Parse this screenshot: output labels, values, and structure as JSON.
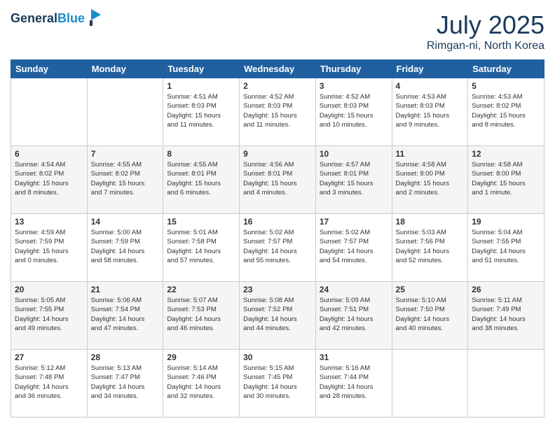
{
  "header": {
    "logo_line1": "General",
    "logo_line2": "Blue",
    "month": "July 2025",
    "location": "Rimgan-ni, North Korea"
  },
  "weekdays": [
    "Sunday",
    "Monday",
    "Tuesday",
    "Wednesday",
    "Thursday",
    "Friday",
    "Saturday"
  ],
  "weeks": [
    [
      {
        "day": "",
        "info": ""
      },
      {
        "day": "",
        "info": ""
      },
      {
        "day": "1",
        "info": "Sunrise: 4:51 AM\nSunset: 8:03 PM\nDaylight: 15 hours\nand 11 minutes."
      },
      {
        "day": "2",
        "info": "Sunrise: 4:52 AM\nSunset: 8:03 PM\nDaylight: 15 hours\nand 11 minutes."
      },
      {
        "day": "3",
        "info": "Sunrise: 4:52 AM\nSunset: 8:03 PM\nDaylight: 15 hours\nand 10 minutes."
      },
      {
        "day": "4",
        "info": "Sunrise: 4:53 AM\nSunset: 8:03 PM\nDaylight: 15 hours\nand 9 minutes."
      },
      {
        "day": "5",
        "info": "Sunrise: 4:53 AM\nSunset: 8:02 PM\nDaylight: 15 hours\nand 8 minutes."
      }
    ],
    [
      {
        "day": "6",
        "info": "Sunrise: 4:54 AM\nSunset: 8:02 PM\nDaylight: 15 hours\nand 8 minutes."
      },
      {
        "day": "7",
        "info": "Sunrise: 4:55 AM\nSunset: 8:02 PM\nDaylight: 15 hours\nand 7 minutes."
      },
      {
        "day": "8",
        "info": "Sunrise: 4:55 AM\nSunset: 8:01 PM\nDaylight: 15 hours\nand 6 minutes."
      },
      {
        "day": "9",
        "info": "Sunrise: 4:56 AM\nSunset: 8:01 PM\nDaylight: 15 hours\nand 4 minutes."
      },
      {
        "day": "10",
        "info": "Sunrise: 4:57 AM\nSunset: 8:01 PM\nDaylight: 15 hours\nand 3 minutes."
      },
      {
        "day": "11",
        "info": "Sunrise: 4:58 AM\nSunset: 8:00 PM\nDaylight: 15 hours\nand 2 minutes."
      },
      {
        "day": "12",
        "info": "Sunrise: 4:58 AM\nSunset: 8:00 PM\nDaylight: 15 hours\nand 1 minute."
      }
    ],
    [
      {
        "day": "13",
        "info": "Sunrise: 4:59 AM\nSunset: 7:59 PM\nDaylight: 15 hours\nand 0 minutes."
      },
      {
        "day": "14",
        "info": "Sunrise: 5:00 AM\nSunset: 7:59 PM\nDaylight: 14 hours\nand 58 minutes."
      },
      {
        "day": "15",
        "info": "Sunrise: 5:01 AM\nSunset: 7:58 PM\nDaylight: 14 hours\nand 57 minutes."
      },
      {
        "day": "16",
        "info": "Sunrise: 5:02 AM\nSunset: 7:57 PM\nDaylight: 14 hours\nand 55 minutes."
      },
      {
        "day": "17",
        "info": "Sunrise: 5:02 AM\nSunset: 7:57 PM\nDaylight: 14 hours\nand 54 minutes."
      },
      {
        "day": "18",
        "info": "Sunrise: 5:03 AM\nSunset: 7:56 PM\nDaylight: 14 hours\nand 52 minutes."
      },
      {
        "day": "19",
        "info": "Sunrise: 5:04 AM\nSunset: 7:55 PM\nDaylight: 14 hours\nand 51 minutes."
      }
    ],
    [
      {
        "day": "20",
        "info": "Sunrise: 5:05 AM\nSunset: 7:55 PM\nDaylight: 14 hours\nand 49 minutes."
      },
      {
        "day": "21",
        "info": "Sunrise: 5:06 AM\nSunset: 7:54 PM\nDaylight: 14 hours\nand 47 minutes."
      },
      {
        "day": "22",
        "info": "Sunrise: 5:07 AM\nSunset: 7:53 PM\nDaylight: 14 hours\nand 46 minutes."
      },
      {
        "day": "23",
        "info": "Sunrise: 5:08 AM\nSunset: 7:52 PM\nDaylight: 14 hours\nand 44 minutes."
      },
      {
        "day": "24",
        "info": "Sunrise: 5:09 AM\nSunset: 7:51 PM\nDaylight: 14 hours\nand 42 minutes."
      },
      {
        "day": "25",
        "info": "Sunrise: 5:10 AM\nSunset: 7:50 PM\nDaylight: 14 hours\nand 40 minutes."
      },
      {
        "day": "26",
        "info": "Sunrise: 5:11 AM\nSunset: 7:49 PM\nDaylight: 14 hours\nand 38 minutes."
      }
    ],
    [
      {
        "day": "27",
        "info": "Sunrise: 5:12 AM\nSunset: 7:48 PM\nDaylight: 14 hours\nand 36 minutes."
      },
      {
        "day": "28",
        "info": "Sunrise: 5:13 AM\nSunset: 7:47 PM\nDaylight: 14 hours\nand 34 minutes."
      },
      {
        "day": "29",
        "info": "Sunrise: 5:14 AM\nSunset: 7:46 PM\nDaylight: 14 hours\nand 32 minutes."
      },
      {
        "day": "30",
        "info": "Sunrise: 5:15 AM\nSunset: 7:45 PM\nDaylight: 14 hours\nand 30 minutes."
      },
      {
        "day": "31",
        "info": "Sunrise: 5:16 AM\nSunset: 7:44 PM\nDaylight: 14 hours\nand 28 minutes."
      },
      {
        "day": "",
        "info": ""
      },
      {
        "day": "",
        "info": ""
      }
    ]
  ]
}
